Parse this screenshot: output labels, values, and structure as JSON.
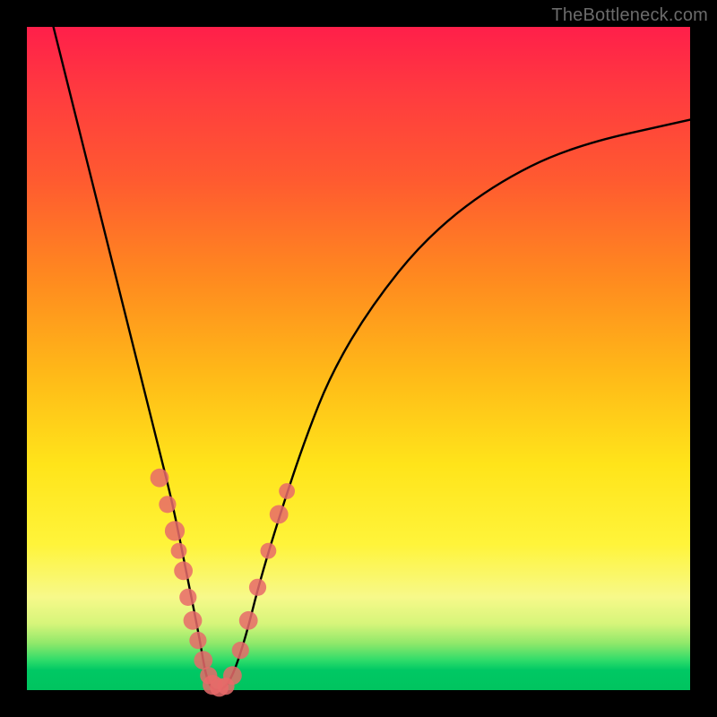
{
  "watermark": "TheBottleneck.com",
  "colors": {
    "frame": "#000000",
    "point": "#e76a6a",
    "curve": "#000000"
  },
  "chart_data": {
    "type": "line",
    "title": "",
    "xlabel": "",
    "ylabel": "",
    "xlim": [
      0,
      100
    ],
    "ylim": [
      0,
      100
    ],
    "grid": false,
    "legend": false,
    "series": [
      {
        "name": "bottleneck-v-curve",
        "x": [
          4,
          6,
          8,
          10,
          12,
          14,
          16,
          18,
          20,
          22,
          24,
          26,
          27,
          28,
          29.5,
          31,
          33,
          35,
          38,
          42,
          46,
          52,
          60,
          70,
          82,
          100
        ],
        "y": [
          100,
          92,
          84,
          76,
          68,
          60,
          52,
          44,
          36,
          28,
          18,
          8,
          2,
          0,
          0,
          2,
          8,
          16,
          26,
          38,
          48,
          58,
          68,
          76,
          82,
          86
        ]
      }
    ],
    "points": [
      {
        "x": 20.0,
        "y": 32.0,
        "r": 1.4
      },
      {
        "x": 21.2,
        "y": 28.0,
        "r": 1.3
      },
      {
        "x": 22.3,
        "y": 24.0,
        "r": 1.5
      },
      {
        "x": 22.9,
        "y": 21.0,
        "r": 1.2
      },
      {
        "x": 23.6,
        "y": 18.0,
        "r": 1.4
      },
      {
        "x": 24.3,
        "y": 14.0,
        "r": 1.3
      },
      {
        "x": 25.0,
        "y": 10.5,
        "r": 1.4
      },
      {
        "x": 25.8,
        "y": 7.5,
        "r": 1.3
      },
      {
        "x": 26.6,
        "y": 4.5,
        "r": 1.4
      },
      {
        "x": 27.4,
        "y": 2.2,
        "r": 1.3
      },
      {
        "x": 28.0,
        "y": 0.8,
        "r": 1.5
      },
      {
        "x": 29.0,
        "y": 0.4,
        "r": 1.4
      },
      {
        "x": 30.0,
        "y": 0.6,
        "r": 1.3
      },
      {
        "x": 31.0,
        "y": 2.2,
        "r": 1.4
      },
      {
        "x": 32.2,
        "y": 6.0,
        "r": 1.3
      },
      {
        "x": 33.4,
        "y": 10.5,
        "r": 1.4
      },
      {
        "x": 34.8,
        "y": 15.5,
        "r": 1.3
      },
      {
        "x": 36.4,
        "y": 21.0,
        "r": 1.2
      },
      {
        "x": 38.0,
        "y": 26.5,
        "r": 1.4
      },
      {
        "x": 39.2,
        "y": 30.0,
        "r": 1.2
      }
    ]
  }
}
